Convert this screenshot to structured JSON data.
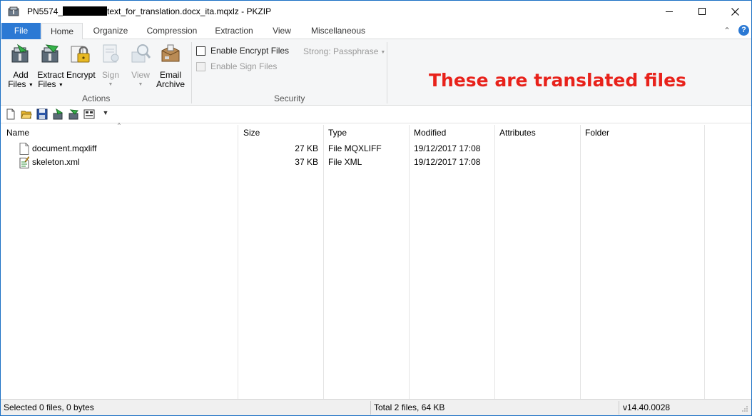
{
  "window": {
    "title_prefix": "PN5574_",
    "title_suffix": "text_for_translation.docx_ita.mqxlz - PKZIP"
  },
  "ribbon": {
    "tabs": [
      "File",
      "Home",
      "Organize",
      "Compression",
      "Extraction",
      "View",
      "Miscellaneous"
    ],
    "active_tab": "Home",
    "actions": {
      "add_files": [
        "Add",
        "Files"
      ],
      "extract_files": [
        "Extract",
        "Files"
      ],
      "encrypt": "Encrypt",
      "sign": "Sign",
      "view": "View",
      "email_archive": [
        "Email",
        "Archive"
      ],
      "group_label": "Actions"
    },
    "security": {
      "enable_encrypt_files": "Enable Encrypt Files",
      "enable_sign_files": "Enable Sign Files",
      "strength": "Strong: Passphrase",
      "group_label": "Security"
    },
    "help_symbol": "?"
  },
  "annotation": "These are translated files",
  "file_list": {
    "columns": [
      "Name",
      "Size",
      "Type",
      "Modified",
      "Attributes",
      "Folder"
    ],
    "rows": [
      {
        "name": "document.mqxliff",
        "size": "27 KB",
        "type": "File MQXLIFF",
        "modified": "19/12/2017 17:08",
        "attributes": "",
        "folder": "",
        "icon": "blank-document-icon"
      },
      {
        "name": "skeleton.xml",
        "size": "37 KB",
        "type": "File XML",
        "modified": "19/12/2017 17:08",
        "attributes": "",
        "folder": "",
        "icon": "xml-document-icon"
      }
    ]
  },
  "status": {
    "selected": "Selected 0 files, 0 bytes",
    "total": "Total 2 files, 64 KB",
    "version": "v14.40.0028"
  },
  "colors": {
    "file_tab": "#2b79d4",
    "annotation": "#e8221b",
    "ribbon_bg": "#f5f6f7"
  }
}
